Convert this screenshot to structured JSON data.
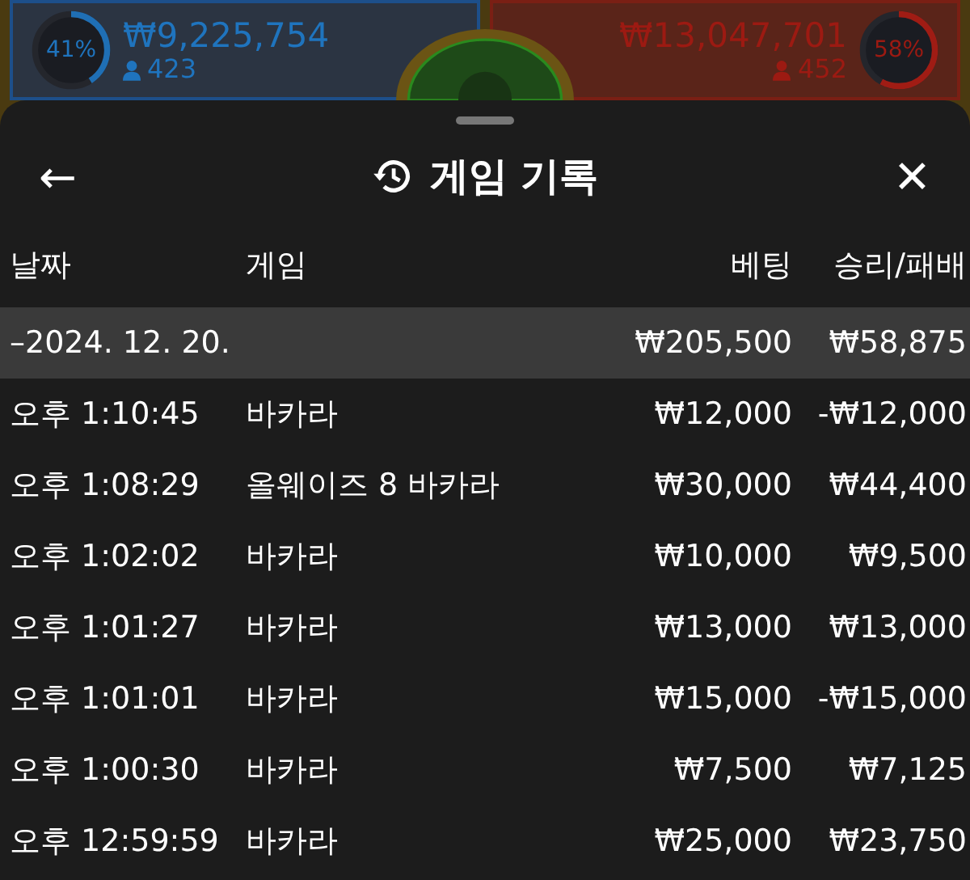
{
  "game_panel": {
    "player": {
      "percent": "41%",
      "level": 0.41,
      "amount": "₩9,225,754",
      "count": "423"
    },
    "banker": {
      "percent": "58%",
      "level": 0.58,
      "amount": "₩13,047,701",
      "count": "452"
    }
  },
  "sheet": {
    "title": "게임 기록",
    "back_icon": "←",
    "close_icon": "✕"
  },
  "table": {
    "columns": [
      "날짜",
      "게임",
      "베팅",
      "승리/패배"
    ],
    "group": {
      "date": "–2024. 12. 20.",
      "bet": "₩205,500",
      "result": "₩58,875"
    },
    "rows": [
      {
        "time": "오후 1:10:45",
        "game": "바카라",
        "bet": "₩12,000",
        "result": "-₩12,000"
      },
      {
        "time": "오후 1:08:29",
        "game": "올웨이즈 8 바카라",
        "bet": "₩30,000",
        "result": "₩44,400"
      },
      {
        "time": "오후 1:02:02",
        "game": "바카라",
        "bet": "₩10,000",
        "result": "₩9,500"
      },
      {
        "time": "오후 1:01:27",
        "game": "바카라",
        "bet": "₩13,000",
        "result": "₩13,000"
      },
      {
        "time": "오후 1:01:01",
        "game": "바카라",
        "bet": "₩15,000",
        "result": "-₩15,000"
      },
      {
        "time": "오후 1:00:30",
        "game": "바카라",
        "bet": "₩7,500",
        "result": "₩7,125"
      },
      {
        "time": "오후 12:59:59",
        "game": "바카라",
        "bet": "₩25,000",
        "result": "₩23,750"
      }
    ]
  }
}
